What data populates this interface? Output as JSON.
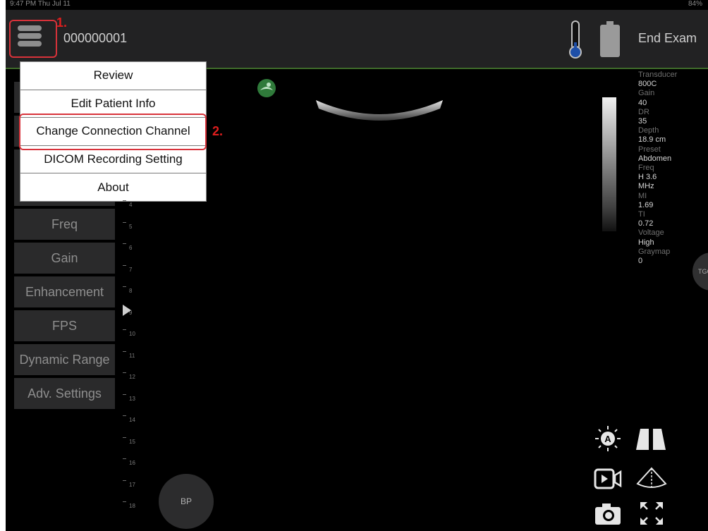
{
  "status": {
    "time": "9:47 PM   Thu Jul 11",
    "battery": "84%"
  },
  "header": {
    "patient_id": "000000001",
    "end_exam": "End Exam"
  },
  "callouts": {
    "step1": "1.",
    "step2": "2."
  },
  "menu": {
    "items": [
      {
        "label": "Review"
      },
      {
        "label": "Edit Patient Info"
      },
      {
        "label": "Change Connection Channel"
      },
      {
        "label": "DICOM Recording Setting"
      },
      {
        "label": "About"
      }
    ]
  },
  "sidebar": {
    "items": [
      {
        "label": "Freq"
      },
      {
        "label": "Gain"
      },
      {
        "label": "Enhancement"
      },
      {
        "label": "FPS"
      },
      {
        "label": "Dynamic Range"
      },
      {
        "label": "Adv. Settings"
      }
    ]
  },
  "depth_scale": [
    "4",
    "5",
    "6",
    "7",
    "8",
    "9",
    "10",
    "11",
    "12",
    "13",
    "14",
    "15",
    "16",
    "17",
    "18"
  ],
  "params": [
    {
      "label": "Transducer",
      "value": "800C"
    },
    {
      "label": "Gain",
      "value": "40"
    },
    {
      "label": "DR",
      "value": "35"
    },
    {
      "label": "Depth",
      "value": "18.9 cm"
    },
    {
      "label": "Preset",
      "value": "Abdomen"
    },
    {
      "label": "Freq",
      "value": "H 3.6\nMHz"
    },
    {
      "label": "MI",
      "value": "1.69"
    },
    {
      "label": "TI",
      "value": "0.72"
    },
    {
      "label": "Voltage",
      "value": "High"
    },
    {
      "label": "Graymap",
      "value": "0"
    }
  ],
  "tgc": {
    "label": "TGC"
  },
  "bp": {
    "label": "BP"
  },
  "icons": [
    "menu-icon",
    "thermometer-icon",
    "battery-icon",
    "logo-icon",
    "auto-brightness-icon",
    "dual-view-icon",
    "video-record-icon",
    "sector-icon",
    "camera-icon",
    "fullscreen-icon"
  ],
  "colors": {
    "highlight_red": "#d8323a",
    "accent_green": "#3f6b2a",
    "thermo_blue": "#1e4fa8"
  }
}
